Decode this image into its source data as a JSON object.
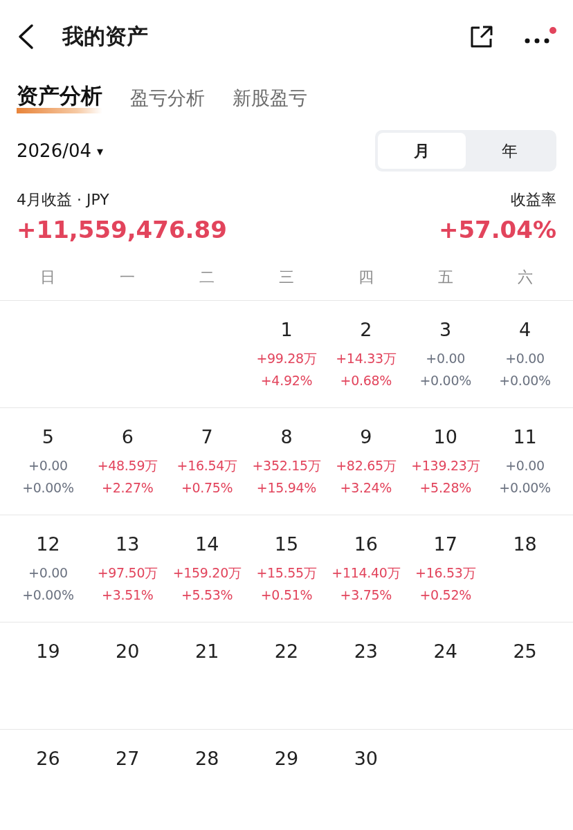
{
  "header": {
    "title": "我的资产",
    "notification_dot": true
  },
  "tabs": [
    {
      "label": "资产分析",
      "selected": true
    },
    {
      "label": "盈亏分析",
      "selected": false
    },
    {
      "label": "新股盈亏",
      "selected": false
    }
  ],
  "period": {
    "date": "2026/04",
    "caret": "▾",
    "options": [
      {
        "label": "月",
        "selected": true
      },
      {
        "label": "年",
        "selected": false
      }
    ]
  },
  "summary": {
    "label": "4月收益 · JPY",
    "value": "+11,559,476.89",
    "rate_label": "收益率",
    "rate": "+57.04%"
  },
  "weekdays": [
    "日",
    "一",
    "二",
    "三",
    "四",
    "五",
    "六"
  ],
  "weeks": [
    {
      "cells": [
        {
          "kind": "blank"
        },
        {
          "kind": "blank"
        },
        {
          "kind": "blank"
        },
        {
          "kind": "day",
          "day": "1",
          "profit": "+99.28万",
          "rate": "+4.92%",
          "color": "#e2445c"
        },
        {
          "kind": "day",
          "day": "2",
          "profit": "+14.33万",
          "rate": "+0.68%",
          "color": "#e2445c"
        },
        {
          "kind": "day",
          "day": "3",
          "profit": "+0.00",
          "rate": "+0.00%",
          "color": "#6b7280"
        },
        {
          "kind": "day",
          "day": "4",
          "profit": "+0.00",
          "rate": "+0.00%",
          "color": "#6b7280"
        }
      ]
    },
    {
      "cells": [
        {
          "kind": "day",
          "day": "5",
          "profit": "+0.00",
          "rate": "+0.00%",
          "color": "#6b7280"
        },
        {
          "kind": "day",
          "day": "6",
          "profit": "+48.59万",
          "rate": "+2.27%",
          "color": "#e2445c"
        },
        {
          "kind": "day",
          "day": "7",
          "profit": "+16.54万",
          "rate": "+0.75%",
          "color": "#e2445c"
        },
        {
          "kind": "day",
          "day": "8",
          "profit": "+352.15万",
          "rate": "+15.94%",
          "color": "#e2445c"
        },
        {
          "kind": "day",
          "day": "9",
          "profit": "+82.65万",
          "rate": "+3.24%",
          "color": "#e2445c"
        },
        {
          "kind": "day",
          "day": "10",
          "profit": "+139.23万",
          "rate": "+5.28%",
          "color": "#e2445c"
        },
        {
          "kind": "day",
          "day": "11",
          "profit": "+0.00",
          "rate": "+0.00%",
          "color": "#6b7280"
        }
      ]
    },
    {
      "cells": [
        {
          "kind": "day",
          "day": "12",
          "profit": "+0.00",
          "rate": "+0.00%",
          "color": "#6b7280"
        },
        {
          "kind": "day",
          "day": "13",
          "profit": "+97.50万",
          "rate": "+3.51%",
          "color": "#e2445c"
        },
        {
          "kind": "day",
          "day": "14",
          "profit": "+159.20万",
          "rate": "+5.53%",
          "color": "#e2445c"
        },
        {
          "kind": "day",
          "day": "15",
          "profit": "+15.55万",
          "rate": "+0.51%",
          "color": "#e2445c"
        },
        {
          "kind": "day",
          "day": "16",
          "profit": "+114.40万",
          "rate": "+3.75%",
          "color": "#e2445c"
        },
        {
          "kind": "day",
          "day": "17",
          "profit": "+16.53万",
          "rate": "+0.52%",
          "color": "#e2445c"
        },
        {
          "kind": "day",
          "day": "18"
        }
      ]
    },
    {
      "cells": [
        {
          "kind": "day",
          "day": "19"
        },
        {
          "kind": "day",
          "day": "20"
        },
        {
          "kind": "day",
          "day": "21"
        },
        {
          "kind": "day",
          "day": "22"
        },
        {
          "kind": "day",
          "day": "23"
        },
        {
          "kind": "day",
          "day": "24"
        },
        {
          "kind": "day",
          "day": "25"
        }
      ]
    },
    {
      "cells": [
        {
          "kind": "day",
          "day": "26"
        },
        {
          "kind": "day",
          "day": "27"
        },
        {
          "kind": "day",
          "day": "28"
        },
        {
          "kind": "day",
          "day": "29"
        },
        {
          "kind": "day",
          "day": "30"
        },
        {
          "kind": "blank"
        },
        {
          "kind": "blank"
        }
      ]
    }
  ]
}
